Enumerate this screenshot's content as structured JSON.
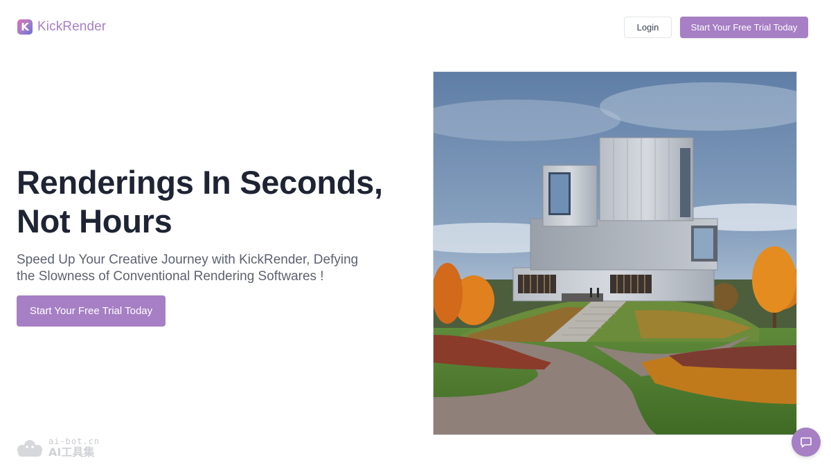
{
  "brand": {
    "name": "KickRender",
    "logo_letter": "K",
    "accent": "#a67fc4"
  },
  "header": {
    "login_label": "Login",
    "cta_label": "Start Your Free Trial Today"
  },
  "hero": {
    "title_line1": "Renderings In Seconds,",
    "title_line2": "Not Hours",
    "subtitle_line1": "Speed Up Your Creative Journey with KickRender, Defying",
    "subtitle_line2": "the Slowness of Conventional Rendering Softwares !",
    "cta_label": "Start Your Free Trial Today",
    "image_icon": "architecture-render-image"
  },
  "watermark": {
    "line1": "ai-bot.cn",
    "line2": "AI工具集"
  },
  "chat": {
    "icon": "chat-icon"
  }
}
